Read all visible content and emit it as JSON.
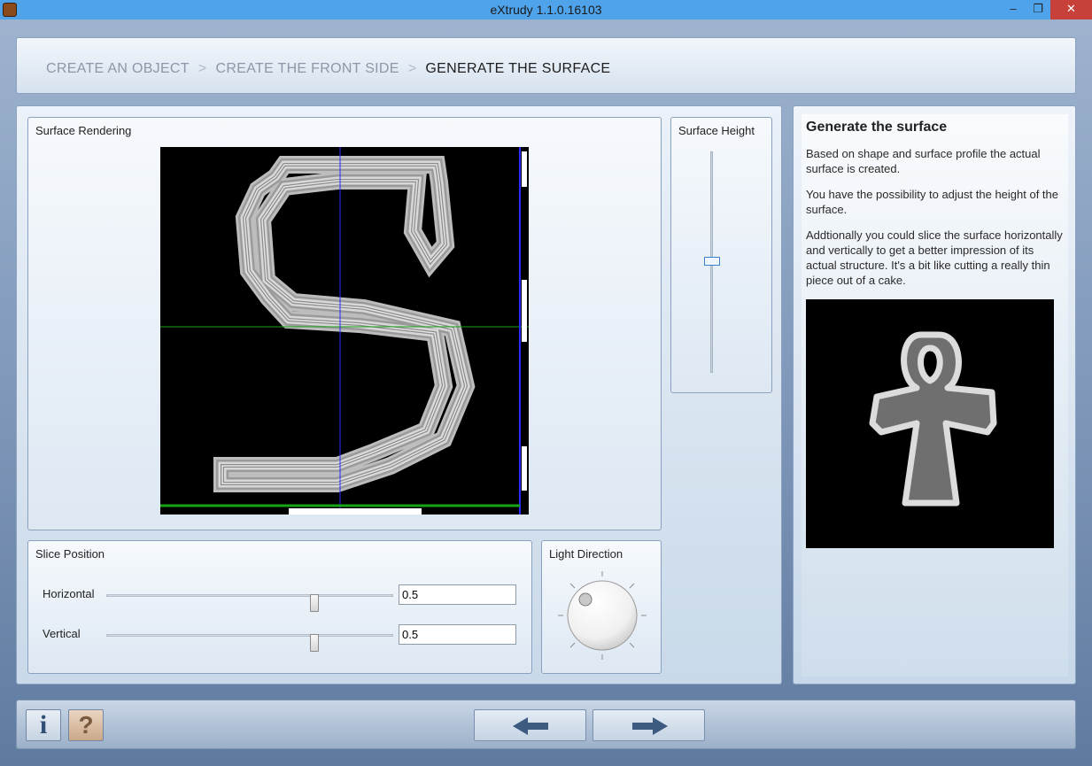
{
  "window": {
    "title": "eXtrudy 1.1.0.16103",
    "min_glyph": "–",
    "max_glyph": "❐",
    "close_glyph": "✕"
  },
  "breadcrumb": {
    "steps": [
      "CREATE AN OBJECT",
      "CREATE THE FRONT SIDE",
      "GENERATE THE SURFACE"
    ],
    "separator": ">",
    "active_index": 2
  },
  "surface_rendering": {
    "label": "Surface Rendering"
  },
  "surface_height": {
    "label": "Surface Height",
    "value_fraction": 0.5
  },
  "slice_position": {
    "label": "Slice Position",
    "horizontal": {
      "label": "Horizontal",
      "value": "0.5"
    },
    "vertical": {
      "label": "Vertical",
      "value": "0.5"
    }
  },
  "light_direction": {
    "label": "Light Direction"
  },
  "info": {
    "title": "Generate the surface",
    "paragraphs": [
      "Based on shape and surface profile the actual surface is created.",
      "You have the possibility to adjust the height of the surface.",
      "Addtionally you could slice the surface horizontally and vertically to get a better impression of its actual structure. It's a bit like cutting a really thin piece out of a cake."
    ]
  },
  "bottom": {
    "info_glyph": "i",
    "help_glyph": "?",
    "back_icon": "arrow-left-icon",
    "next_icon": "arrow-right-icon"
  },
  "colors": {
    "accent": "#3a7fd0",
    "titlebar": "#4fa3ea",
    "close": "#c7403a"
  }
}
